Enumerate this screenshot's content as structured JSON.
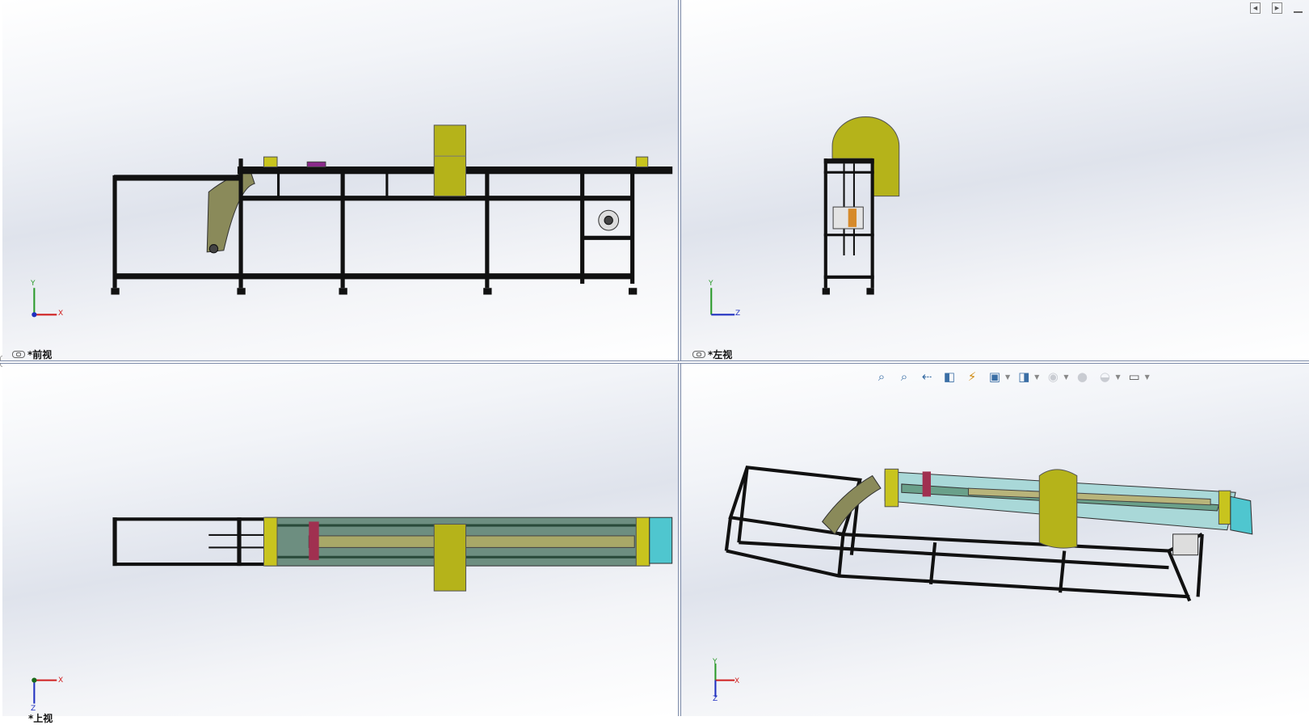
{
  "viewports": [
    {
      "label": "*前视",
      "triad": {
        "h": "X",
        "v": "Y"
      }
    },
    {
      "label": "*左视",
      "triad": {
        "h": "Z",
        "v": "Y"
      }
    },
    {
      "label": "*上视",
      "triad": {
        "h": "X",
        "v": "Z"
      }
    },
    {
      "label": "",
      "triad": {
        "h": "X",
        "v": "Y",
        "d": "Z"
      }
    }
  ],
  "toolbar": {
    "items": [
      {
        "icon": "zoom-to-fit-icon",
        "glyph": "⌕"
      },
      {
        "icon": "zoom-to-area-icon",
        "glyph": "⌕"
      },
      {
        "icon": "previous-view-icon",
        "glyph": "⇠"
      },
      {
        "icon": "section-view-icon",
        "glyph": "◧"
      },
      {
        "icon": "dynamic-annotation-icon",
        "glyph": "⚡"
      },
      {
        "icon": "view-orientation-icon",
        "glyph": "▣"
      },
      {
        "icon": "display-style-icon",
        "glyph": "◨"
      },
      {
        "icon": "hide-show-items-icon",
        "glyph": "◉"
      },
      {
        "icon": "edit-appearance-icon",
        "glyph": "●"
      },
      {
        "icon": "apply-scene-icon",
        "glyph": "◒"
      },
      {
        "icon": "view-settings-icon",
        "glyph": "▭"
      }
    ]
  },
  "colors": {
    "frame": "#111111",
    "yellow": "#b5b31a",
    "conveyor": "#6d8e80",
    "cyan": "#4fc6cf"
  }
}
